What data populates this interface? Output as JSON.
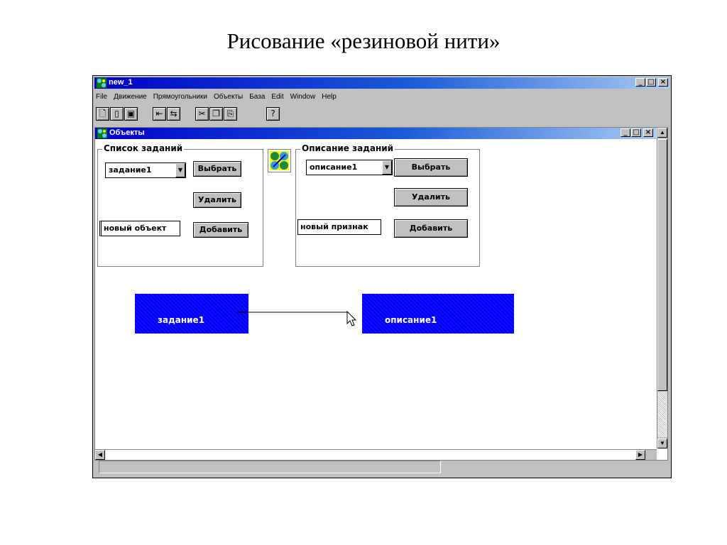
{
  "slide": {
    "title": "Рисование «резиновой  нити»"
  },
  "app": {
    "title": "new_1",
    "menu": [
      "File",
      "Движение",
      "Прямоугольники",
      "Объекты",
      "База",
      "Edit",
      "Window",
      "Help"
    ],
    "toolbar_icons": [
      "new-doc-icon",
      "open-icon",
      "save-icon",
      "undo-icon",
      "redo-icon",
      "cut-icon",
      "copy-icon",
      "paste-icon",
      "help-icon"
    ]
  },
  "child": {
    "title": "Объекты",
    "tasks_group": {
      "label": "Список заданий",
      "combo_value": "задание1",
      "select_btn": "Выбрать",
      "delete_btn": "Удалить",
      "new_field": "новый объект",
      "add_btn": "Добавить"
    },
    "desc_group": {
      "label": "Описание заданий",
      "combo_value": "описание1",
      "select_btn": "Выбрать",
      "delete_btn": "Удалить",
      "new_field": "новый признак",
      "add_btn": "Добавить"
    },
    "objects": [
      {
        "label": "задание1"
      },
      {
        "label": "описание1"
      }
    ]
  },
  "colors": {
    "title_bar": "#0000c8",
    "object_fill": "#0000ee",
    "window_bg": "#c0c0c0"
  }
}
